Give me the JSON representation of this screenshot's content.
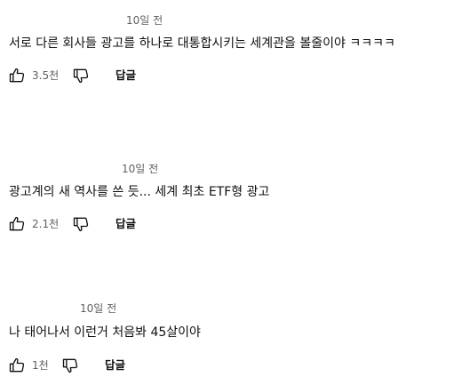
{
  "comments": [
    {
      "timestamp": "10일 전",
      "text": "서로 다른 회사들 광고를 하나로 대통합시키는 세계관을 볼줄이야 ㅋㅋㅋㅋ",
      "like_count": "3.5천",
      "reply_label": "답글"
    },
    {
      "timestamp": "10일 전",
      "text": "광고계의 새 역사를 쓴 듯... 세계 최초 ETF형 광고",
      "like_count": "2.1천",
      "reply_label": "답글"
    },
    {
      "timestamp": "10일 전",
      "text": "나 태어나서 이런거 처음봐 45살이야",
      "like_count": "1천",
      "reply_label": "답글"
    }
  ],
  "icons": {
    "like": "thumbs-up-outline-icon",
    "dislike": "thumbs-down-outline-icon"
  },
  "colors": {
    "text": "#0f0f0f",
    "secondary_text": "#606060",
    "background": "#ffffff"
  }
}
